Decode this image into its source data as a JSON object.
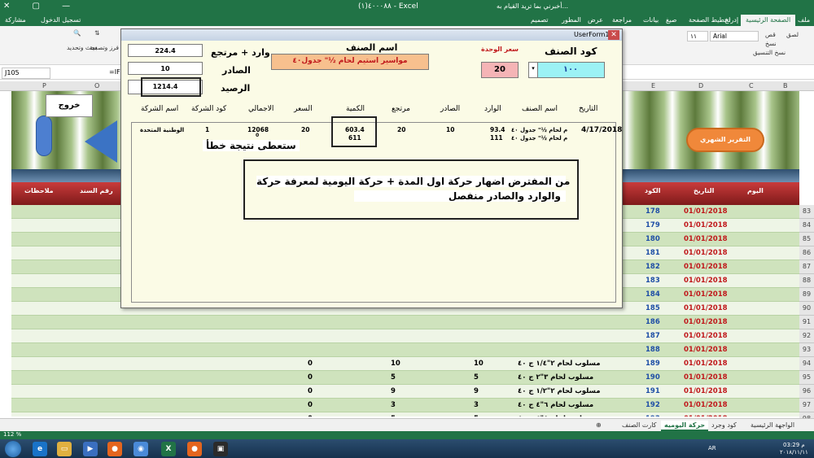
{
  "window": {
    "title": "(١)٤٠٠٠٨٨ - Excel",
    "tell_me": "أخبرني بما تريد القيام به...",
    "tools_label": "أدوات تصميم"
  },
  "ribbon_tabs": [
    "ملف",
    "الصفحة الرئيسية",
    "إدراج",
    "تخطيط الصفحة",
    "صيغ",
    "بيانات",
    "مراجعة",
    "عرض",
    "المطور",
    "تصميم"
  ],
  "account": {
    "sign_in": "تسجيل الدخول",
    "share": "مشاركة"
  },
  "ribbon_items": {
    "font": "Arial",
    "size": "١١",
    "paste": "لصق",
    "cut": "قص",
    "copy": "نسخ",
    "format_painter": "نسخ التنسيق",
    "find": "بحث وتحديد",
    "sort": "فرز وتصفية"
  },
  "formula_bar": {
    "name_box": "J105",
    "formula": "=IFERROR("
  },
  "columns": [
    "P",
    "O",
    "E",
    "D",
    "C",
    "B"
  ],
  "sheet": {
    "exit": "خروج",
    "orange_button": "التقرير الشهري",
    "headers": {
      "notes": "ملاحظات",
      "doc_no": "رقم السند",
      "code": "الكود",
      "date": "التاريخ",
      "day": "اليوم"
    },
    "rows": [
      {
        "num": "83",
        "code": "178",
        "date": "01/01/2018"
      },
      {
        "num": "84",
        "code": "179",
        "date": "01/01/2018"
      },
      {
        "num": "85",
        "code": "180",
        "date": "01/01/2018"
      },
      {
        "num": "86",
        "code": "181",
        "date": "01/01/2018"
      },
      {
        "num": "87",
        "code": "182",
        "date": "01/01/2018"
      },
      {
        "num": "88",
        "code": "183",
        "date": "01/01/2018"
      },
      {
        "num": "89",
        "code": "184",
        "date": "01/01/2018"
      },
      {
        "num": "90",
        "code": "185",
        "date": "01/01/2018"
      },
      {
        "num": "91",
        "code": "186",
        "date": "01/01/2018"
      },
      {
        "num": "92",
        "code": "187",
        "date": "01/01/2018"
      },
      {
        "num": "93",
        "code": "188",
        "date": "01/01/2018"
      },
      {
        "num": "94",
        "code": "189",
        "date": "01/01/2018",
        "item": "مسلوب لحام ٢\"١/٤ ج ٤٠",
        "qty": "10",
        "sold": "10",
        "balance": "0"
      },
      {
        "num": "95",
        "code": "190",
        "date": "01/01/2018",
        "item": "مسلوب لحام ٣\"٢ ج ٤٠",
        "qty": "5",
        "sold": "5",
        "balance": "0"
      },
      {
        "num": "96",
        "code": "191",
        "date": "01/01/2018",
        "item": "مسلوب لحام ٢\"١/٢ ج ٤٠",
        "qty": "9",
        "sold": "9",
        "balance": "0"
      },
      {
        "num": "97",
        "code": "192",
        "date": "01/01/2018",
        "item": "مسلوب لحام ٦\"٤ ج ٤٠",
        "qty": "3",
        "sold": "3",
        "balance": "0"
      },
      {
        "num": "98",
        "code": "193",
        "date": "01/01/2018",
        "item": "مسلوب لحام ٥\"٤ ج ٤٠",
        "qty": "5",
        "sold": "5",
        "balance": "0"
      }
    ]
  },
  "sheet_tabs": [
    "الواجهة الرئيسية",
    "كود وجرد",
    "حركة اليوميه",
    "كارت الصنف"
  ],
  "active_sheet_tab": "حركة اليوميه",
  "status": {
    "zoom": "112 %"
  },
  "taskbar": {
    "time": "م 03:29",
    "date": "٢٠١٨/١١/١١",
    "lang": "AR"
  },
  "userform": {
    "title": "UserForm1",
    "item_code_label": "كود الصنف",
    "item_code_value": "١٠٠",
    "unit_price_label": "سعر الوحدة",
    "unit_price_value": "20",
    "item_name_label": "اسم الصنف",
    "item_name_value": "مواسير استيم لحام ½\" جدول٤٠",
    "in_plus_return_label": "وارد + مرتجع",
    "in_plus_return_value": "224.4",
    "out_label": "الصادر",
    "out_value": "10",
    "balance_label": "الرصيد",
    "balance_value": "1214.4",
    "col_headers": [
      "التاريخ",
      "اسم الصنف",
      "الوارد",
      "الصادر",
      "مرتجع",
      "الكمية",
      "السعر",
      "الاجمالي",
      "كود الشركة",
      "اسم الشركة"
    ],
    "row": {
      "date": "4/17/2018",
      "item_1": "م لحام ½\" جدول ٤٠",
      "item_2": "م لحام ½\" جدول ٤٠",
      "in_1": "93.4",
      "in_2": "111",
      "out": "10",
      "return": "20",
      "qty_1": "603.4",
      "qty_2": "611",
      "price": "20",
      "total": "12068",
      "total_sub": "0",
      "company_code": "1",
      "company_name": "الوطنية المتحدة"
    },
    "note_wrong": "ستعطى نتيجة خطأ",
    "note_main_1": "من المفترض اضهار حركة اول المدة + حركة اليومية لمعرفة حركة",
    "note_main_2": "والوارد والصادر منفصل"
  }
}
